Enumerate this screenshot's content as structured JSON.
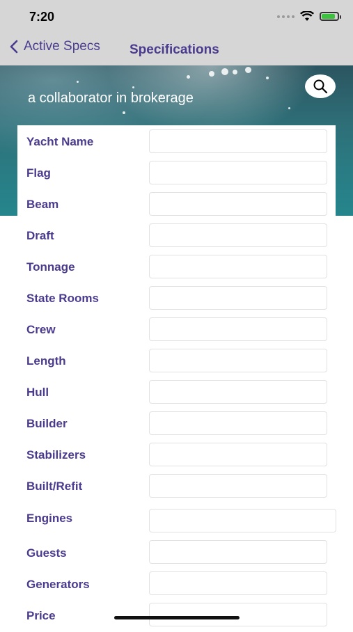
{
  "status": {
    "time": "7:20"
  },
  "nav": {
    "back_label": "Active Specs",
    "title": "Specifications"
  },
  "banner": {
    "tagline": "a collaborator in brokerage"
  },
  "form": {
    "fields": [
      {
        "label": "Yacht Name",
        "value": ""
      },
      {
        "label": "Flag",
        "value": ""
      },
      {
        "label": "Beam",
        "value": ""
      },
      {
        "label": "Draft",
        "value": ""
      },
      {
        "label": "Tonnage",
        "value": ""
      },
      {
        "label": "State Rooms",
        "value": ""
      },
      {
        "label": "Crew",
        "value": ""
      },
      {
        "label": "Length",
        "value": ""
      },
      {
        "label": "Hull",
        "value": ""
      },
      {
        "label": "Builder",
        "value": ""
      },
      {
        "label": "Stabilizers",
        "value": ""
      },
      {
        "label": "Built/Refit",
        "value": ""
      },
      {
        "label": "Engines",
        "value": ""
      },
      {
        "label": "Guests",
        "value": ""
      },
      {
        "label": "Generators",
        "value": ""
      },
      {
        "label": "Price",
        "value": ""
      }
    ]
  },
  "colors": {
    "accent": "#4b3b8f",
    "nav_bg": "#d6d6d6",
    "banner": "#2a7c84"
  }
}
